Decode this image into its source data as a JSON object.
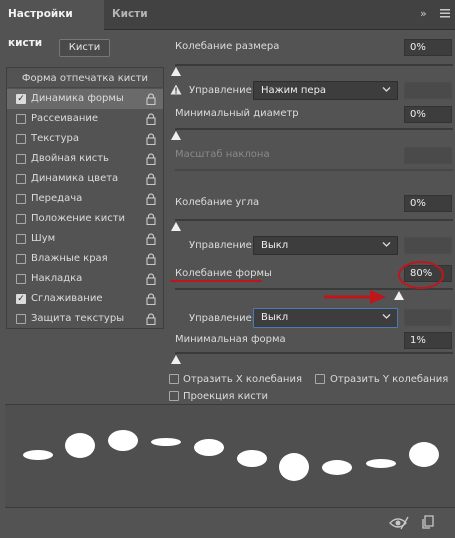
{
  "header": {
    "tabs": [
      {
        "label": "Настройки кисти"
      },
      {
        "label": "Кисти"
      }
    ],
    "menu_icons": [
      "double-chevron-right-icon",
      "hamburger-menu-icon"
    ]
  },
  "left": {
    "brushes_button": "Кисти",
    "list_header": "Форма отпечатка кисти",
    "items": [
      {
        "label": "Динамика формы",
        "checked": true,
        "selected": true
      },
      {
        "label": "Рассеивание",
        "checked": false
      },
      {
        "label": "Текстура",
        "checked": false
      },
      {
        "label": "Двойная кисть",
        "checked": false
      },
      {
        "label": "Динамика цвета",
        "checked": false
      },
      {
        "label": "Передача",
        "checked": false
      },
      {
        "label": "Положение кисти",
        "checked": false
      },
      {
        "label": "Шум",
        "checked": false
      },
      {
        "label": "Влажные края",
        "checked": false
      },
      {
        "label": "Накладка",
        "checked": false
      },
      {
        "label": "Сглаживание",
        "checked": true
      },
      {
        "label": "Защита текстуры",
        "checked": false
      }
    ]
  },
  "right": {
    "size_jitter": {
      "label": "Колебание размера",
      "value": "0%",
      "level": 0
    },
    "size_control": {
      "label": "Управление:",
      "value": "Нажим пера"
    },
    "min_diameter": {
      "label": "Минимальный диаметр",
      "value": "0%",
      "level": 0
    },
    "tilt_scale": {
      "label": "Масштаб наклона"
    },
    "angle_jitter": {
      "label": "Колебание угла",
      "value": "0%",
      "level": 0
    },
    "angle_control": {
      "label": "Управление:",
      "value": "Выкл"
    },
    "roundness_jitter": {
      "label": "Колебание формы",
      "value": "80%",
      "level": 0.8
    },
    "roundness_control": {
      "label": "Управление:",
      "value": "Выкл"
    },
    "min_roundness": {
      "label": "Минимальная форма",
      "value": "1%",
      "level": 0
    },
    "flip_x": {
      "label": "Отразить X колебания",
      "checked": false
    },
    "flip_y": {
      "label": "Отразить Y колебания",
      "checked": false
    },
    "brush_projection": {
      "label": "Проекция кисти",
      "checked": false
    }
  },
  "annotation_color": "#c0161b",
  "footer_icons": [
    "eye-toggle-icon",
    "new-brush-icon"
  ]
}
